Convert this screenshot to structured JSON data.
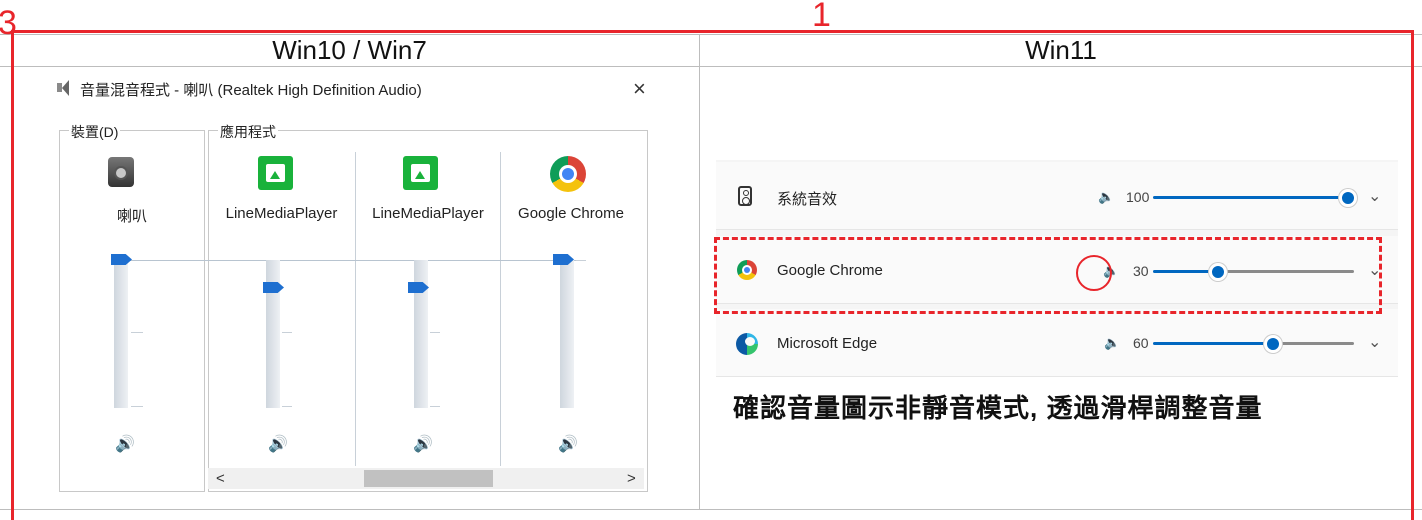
{
  "annotations": {
    "num1": "1",
    "num3": "3"
  },
  "header": {
    "left": "Win10 / Win7",
    "right": "Win11"
  },
  "mixer": {
    "title": "音量混音程式 - 喇叭 (Realtek High Definition Audio)",
    "close_glyph": "×",
    "device_group": "裝置(D)",
    "apps_group": "應用程式",
    "device": {
      "name": "喇叭",
      "level": 1.0
    },
    "apps": [
      {
        "name": "LineMediaPlayer",
        "level": 0.8
      },
      {
        "name": "LineMediaPlayer",
        "level": 0.8
      },
      {
        "name": "Google Chrome",
        "level": 1.0
      }
    ],
    "scroll_left": "<",
    "scroll_right": ">"
  },
  "win11": {
    "rows": [
      {
        "name": "系統音效",
        "volume": 100,
        "icon": "speaker-icon"
      },
      {
        "name": "Google Chrome",
        "volume": 30,
        "icon": "chrome-icon"
      },
      {
        "name": "Microsoft Edge",
        "volume": 60,
        "icon": "edge-icon"
      }
    ],
    "caption": "確認音量圖示非靜音模式, 透過滑桿調整音量"
  },
  "colors": {
    "annotation": "#e8252b",
    "accent": "#0067c0",
    "legacy_accent": "#1e6fd0"
  }
}
